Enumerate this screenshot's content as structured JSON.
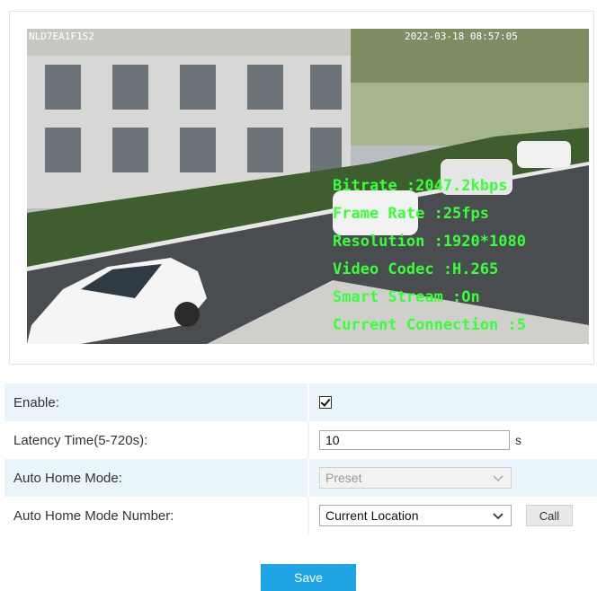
{
  "preview": {
    "osd_top_left": "NLD7EA1F1S2",
    "osd_top_right": "2022-03-18 08:57:05",
    "osd_lines": [
      "Bitrate :2047.2kbps",
      "Frame Rate :25fps",
      "Resolution :1920*1080",
      "Video Codec :H.265",
      "Smart Stream :On",
      "Current Connection :5"
    ]
  },
  "settings": {
    "enable": {
      "label": "Enable:",
      "checked": true
    },
    "latency": {
      "label": "Latency Time(5-720s):",
      "value": "10",
      "unit": "s"
    },
    "auto_home_mode": {
      "label": "Auto Home Mode:",
      "selected": "Preset",
      "disabled": true
    },
    "auto_home_number": {
      "label": "Auto Home Mode Number:",
      "selected": "Current Location",
      "call_label": "Call"
    }
  },
  "footer": {
    "save_label": "Save"
  },
  "colors": {
    "accent": "#1fa5e6",
    "osd_text": "#39ff3a",
    "row_stripe": "#eaf4fb"
  }
}
